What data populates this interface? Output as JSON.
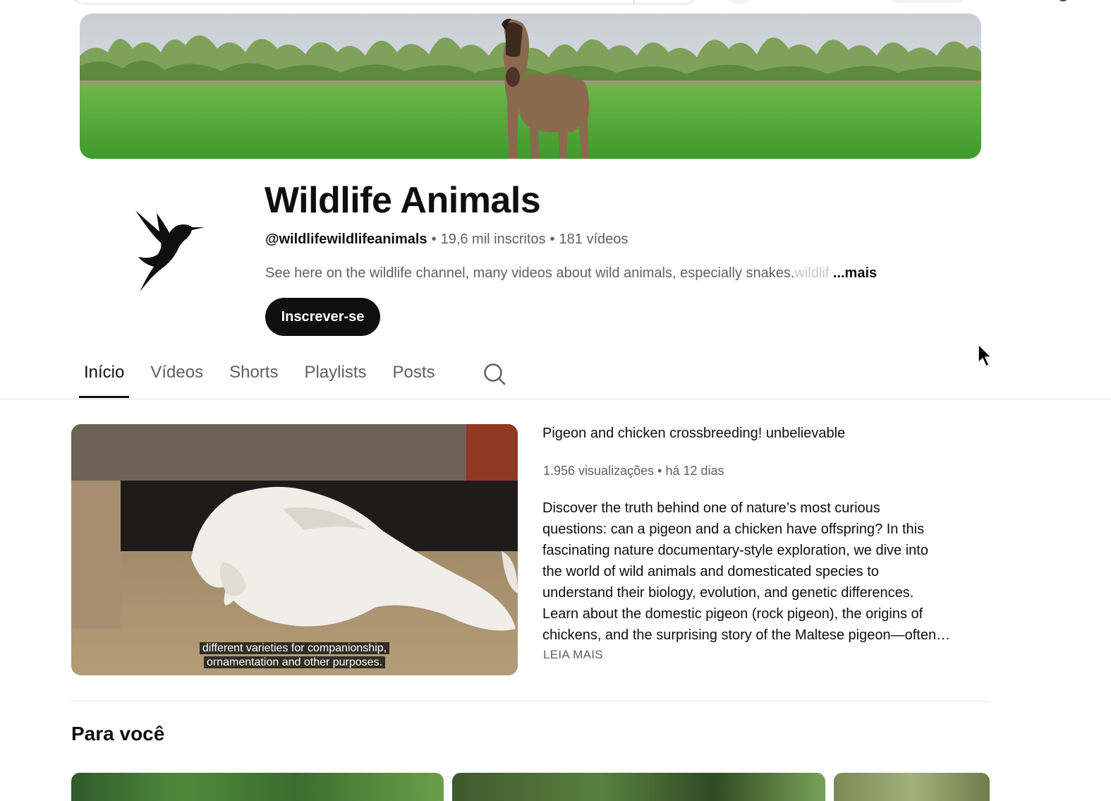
{
  "banner": {
    "alt": ""
  },
  "channel": {
    "name": "Wildlife Animals",
    "handle": "@wildlifewildlifeanimals",
    "subscribers": "19,6 mil inscritos",
    "videos": "181 vídeos",
    "description": "See here on the wildlife channel, many videos about wild animals, especially snakes.",
    "description_faded": "wildlif",
    "more_label": "...mais",
    "subscribe_label": "Inscrever-se"
  },
  "tabs": [
    {
      "label": "Início",
      "active": true
    },
    {
      "label": "Vídeos",
      "active": false
    },
    {
      "label": "Shorts",
      "active": false
    },
    {
      "label": "Playlists",
      "active": false
    },
    {
      "label": "Posts",
      "active": false
    }
  ],
  "featured": {
    "title": "Pigeon and chicken crossbreeding! unbelievable",
    "views": "1.956 visualizações",
    "age": "há 12 dias",
    "caption_line1": "different varieties for companionship,",
    "caption_line2": "ornamentation and other purposes.",
    "description_lines": [
      "Discover the truth behind one of nature’s most curious",
      "questions: can a pigeon and a chicken have offspring? In this",
      "fascinating nature documentary-style exploration, we dive into",
      "the world of wild animals and domesticated species to",
      "understand their biology, evolution, and genetic differences.",
      "Learn about the domestic pigeon (rock pigeon), the origins of",
      "chickens, and the surprising story of the Maltese pigeon—often…"
    ],
    "read_more": "LEIA MAIS"
  },
  "section": {
    "title": "Para você"
  },
  "icons": {
    "search": "search-icon",
    "avatar": "hummingbird-logo",
    "cursor": "mouse-cursor-icon"
  },
  "colors": {
    "subscribe_bg": "#0f0f0f",
    "text_primary": "#0f0f0f",
    "text_secondary": "#606060"
  }
}
